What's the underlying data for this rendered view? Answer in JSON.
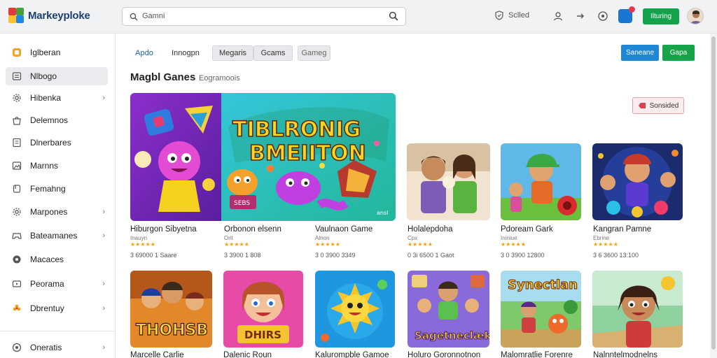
{
  "app": {
    "name": "Markeyploke"
  },
  "search": {
    "placeholder": "Gamni"
  },
  "topbar": {
    "solved_label": "Sclled",
    "button_label": "Ilturing"
  },
  "sidebar": {
    "items": [
      {
        "label": "Iglberan",
        "icon": "grid-icon",
        "chevron": false,
        "active": false
      },
      {
        "label": "Nlbogo",
        "icon": "list-icon",
        "chevron": false,
        "active": true
      },
      {
        "label": "Hibenka",
        "icon": "gear-icon",
        "chevron": true,
        "active": false
      },
      {
        "label": "Delemnos",
        "icon": "bag-icon",
        "chevron": false,
        "active": false
      },
      {
        "label": "Dlnerbares",
        "icon": "document-icon",
        "chevron": false,
        "active": false
      },
      {
        "label": "Marnns",
        "icon": "image-icon",
        "chevron": false,
        "active": false
      },
      {
        "label": "Femahng",
        "icon": "bookmark-icon",
        "chevron": false,
        "active": false
      },
      {
        "label": "Marpones",
        "icon": "gear-icon",
        "chevron": true,
        "active": false
      },
      {
        "label": "Bateamanes",
        "icon": "controller-icon",
        "chevron": true,
        "active": false
      },
      {
        "label": "Macaces",
        "icon": "record-icon",
        "chevron": false,
        "active": false
      },
      {
        "label": "Peorama",
        "icon": "video-icon",
        "chevron": true,
        "active": false
      },
      {
        "label": "Dbrentuy",
        "icon": "flower-icon",
        "chevron": true,
        "active": false
      }
    ],
    "footer": {
      "label": "Oneratis",
      "icon": "settings-icon"
    }
  },
  "tabs": [
    {
      "label": "Apdo"
    },
    {
      "label": "Innogpn"
    },
    {
      "label": "Megaris"
    },
    {
      "label": "Gcams"
    },
    {
      "label": "Gameg"
    }
  ],
  "actions": {
    "blue_button": "Saneane",
    "green_button": "Gapa",
    "red_button": "Sonsided"
  },
  "section": {
    "title": "Magbl Ganes",
    "subtitle": "Eogramoois"
  },
  "featured": {
    "banner_text_line1": "TIBLRONIG",
    "banner_text_line2": "BMEIITON",
    "badge": "SEBS",
    "corner_label": "ansl",
    "items": [
      {
        "title": "Hiburgon Sibyetna",
        "sub": "Inauyn",
        "meta": "3 69000 1 Saare"
      },
      {
        "title": "Orbonon elsenn",
        "sub": "Orit",
        "meta": "3 3900 1 808"
      },
      {
        "title": "Vaulnaon Game",
        "sub": "Alnon",
        "meta": "3 0 3900 3349"
      }
    ]
  },
  "row1": [
    {
      "title": "Holalepdoha",
      "sub": "Cpx",
      "meta": "0 3i 6500 1 Gaot"
    },
    {
      "title": "Pdoream Gark",
      "sub": "Ininiue",
      "meta": "3 0 3900 12800"
    },
    {
      "title": "Kangran Pamne",
      "sub": "Ebrine",
      "meta": "3 6 3600 13:100"
    }
  ],
  "row2": [
    {
      "title": "Marcelle Carlie",
      "art_text": "THOHSB"
    },
    {
      "title": "Dalenic Roun",
      "art_text": "DHIRS"
    },
    {
      "title": "Kalurompble Gamoe",
      "art_text": ""
    },
    {
      "title": "Holuro Goronnotnon",
      "art_text": "Sagetneclæk"
    },
    {
      "title": "Malomratlie Forenre",
      "art_text": "Synectlan"
    },
    {
      "title": "Nalnntelmodnelns",
      "art_text": ""
    }
  ],
  "stars": "★★★★★"
}
